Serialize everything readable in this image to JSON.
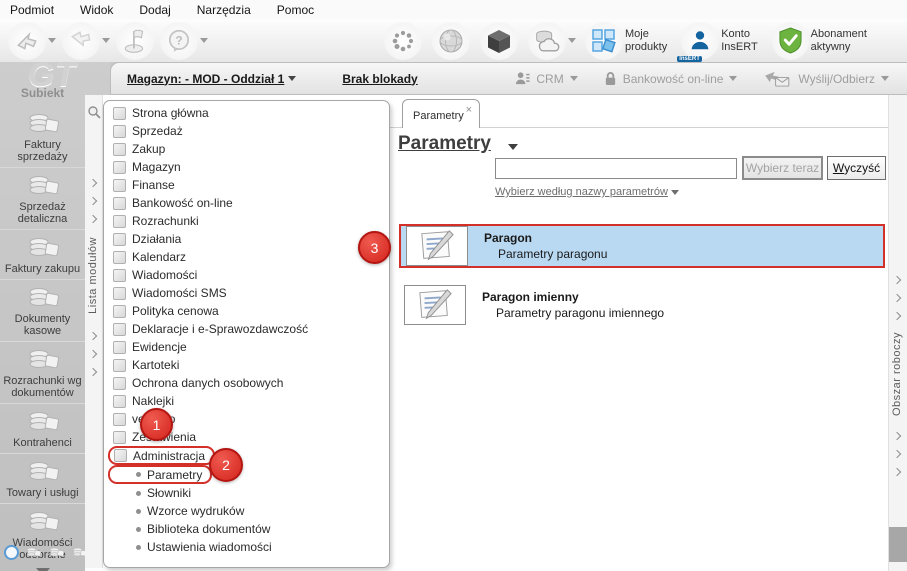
{
  "menu_bar": {
    "items": [
      {
        "label": "Podmiot"
      },
      {
        "label": "Widok"
      },
      {
        "label": "Dodaj"
      },
      {
        "label": "Narzędzia"
      },
      {
        "label": "Pomoc"
      }
    ]
  },
  "toolbar": {
    "left_buttons": [
      {
        "icon": "redo-arrow-icon",
        "caret": true
      },
      {
        "icon": "forward-arrow-icon",
        "caret": true
      },
      {
        "icon": "flag-icon",
        "caret": false
      },
      {
        "icon": "help-balloon-icon",
        "caret": true
      }
    ],
    "moje_produkty_label": "Moje\nprodukty",
    "konto_insert_label": "Konto\nInsERT",
    "insert_badge": "InsERT",
    "abonament_label": "Abonament aktywny"
  },
  "status_bar": {
    "magazyn_label": "Magazyn: - MOD - Oddział 1",
    "brak_blokady_label": "Brak blokady",
    "crm_label": "CRM",
    "bankowosc_label": "Bankowość on-line",
    "wyslij_label": "Wyślij/Odbierz"
  },
  "sidebar": {
    "logo": "GT",
    "app_name": "Subiekt",
    "modules": [
      {
        "label": "Faktury\nsprzedaży",
        "icon": "sales-invoices-icon"
      },
      {
        "label": "Sprzedaż\ndetaliczna",
        "icon": "retail-sales-icon"
      },
      {
        "label": "Faktury zakupu",
        "icon": "purchase-invoices-icon"
      },
      {
        "label": "Dokumenty\nkasowe",
        "icon": "cash-documents-icon"
      },
      {
        "label": "Rozrachunki wg\ndokumentów",
        "icon": "settlements-by-documents-icon"
      },
      {
        "label": "Kontrahenci",
        "icon": "contractors-icon"
      },
      {
        "label": "Towary i usługi",
        "icon": "goods-services-icon"
      },
      {
        "label": "Wiadomości\nodebrane",
        "icon": "received-messages-icon"
      }
    ]
  },
  "module_strip": {
    "label": "Lista modułów"
  },
  "workspace_strip": {
    "label": "Obszar roboczy"
  },
  "tree": {
    "items": [
      {
        "label": "Strona główna",
        "icon": "home-icon"
      },
      {
        "label": "Sprzedaż",
        "icon": "sales-icon"
      },
      {
        "label": "Zakup",
        "icon": "purchase-icon"
      },
      {
        "label": "Magazyn",
        "icon": "warehouse-icon"
      },
      {
        "label": "Finanse",
        "icon": "finance-icon"
      },
      {
        "label": "Bankowość on-line",
        "icon": "online-banking-icon"
      },
      {
        "label": "Rozrachunki",
        "icon": "settlements-icon"
      },
      {
        "label": "Działania",
        "icon": "actions-icon"
      },
      {
        "label": "Kalendarz",
        "icon": "calendar-icon"
      },
      {
        "label": "Wiadomości",
        "icon": "messages-icon"
      },
      {
        "label": "Wiadomości SMS",
        "icon": "sms-icon"
      },
      {
        "label": "Polityka cenowa",
        "icon": "price-policy-icon"
      },
      {
        "label": "Deklaracje i e-Sprawozdawczość",
        "icon": "declarations-icon"
      },
      {
        "label": "Ewidencje",
        "icon": "records-icon"
      },
      {
        "label": "Kartoteki",
        "icon": "card-files-icon"
      },
      {
        "label": "Ochrona danych osobowych",
        "icon": "data-protection-icon"
      },
      {
        "label": "Naklejki",
        "icon": "stickers-icon"
      },
      {
        "label": "vendero",
        "icon": "vendero-icon"
      },
      {
        "label": "Zestawienia",
        "icon": "reports-icon"
      },
      {
        "label": "Administracja",
        "icon": "administration-icon",
        "ring": true
      },
      {
        "label": "Parametry",
        "sub": true,
        "ring": true
      },
      {
        "label": "Słowniki",
        "sub": true
      },
      {
        "label": "Wzorce wydruków",
        "sub": true
      },
      {
        "label": "Biblioteka dokumentów",
        "sub": true
      },
      {
        "label": "Ustawienia wiadomości",
        "sub": true
      }
    ]
  },
  "content": {
    "tab": {
      "label": "Parametry",
      "close": "×"
    },
    "title": "Parametry",
    "search_value": "",
    "select_now_button": "Wybierz teraz",
    "clear_button": "Wyczyść",
    "filter_link": "Wybierz według nazwy parametrów",
    "items": [
      {
        "title": "Paragon",
        "subtitle": "Parametry paragonu",
        "selected": true,
        "icon": "note-pencil-icon"
      },
      {
        "title": "Paragon imienny",
        "subtitle": "Parametry paragonu imiennego",
        "selected": false,
        "icon": "note-pencil-icon"
      }
    ]
  },
  "annotations": [
    {
      "id": "1",
      "number": "1"
    },
    {
      "id": "2",
      "number": "2"
    },
    {
      "id": "3",
      "number": "3"
    }
  ],
  "colors": {
    "annotation_red": "#d3241c",
    "selection_blue": "#b9d8f1",
    "insert_blue": "#1464a0",
    "shield_green": "#66b23c"
  }
}
